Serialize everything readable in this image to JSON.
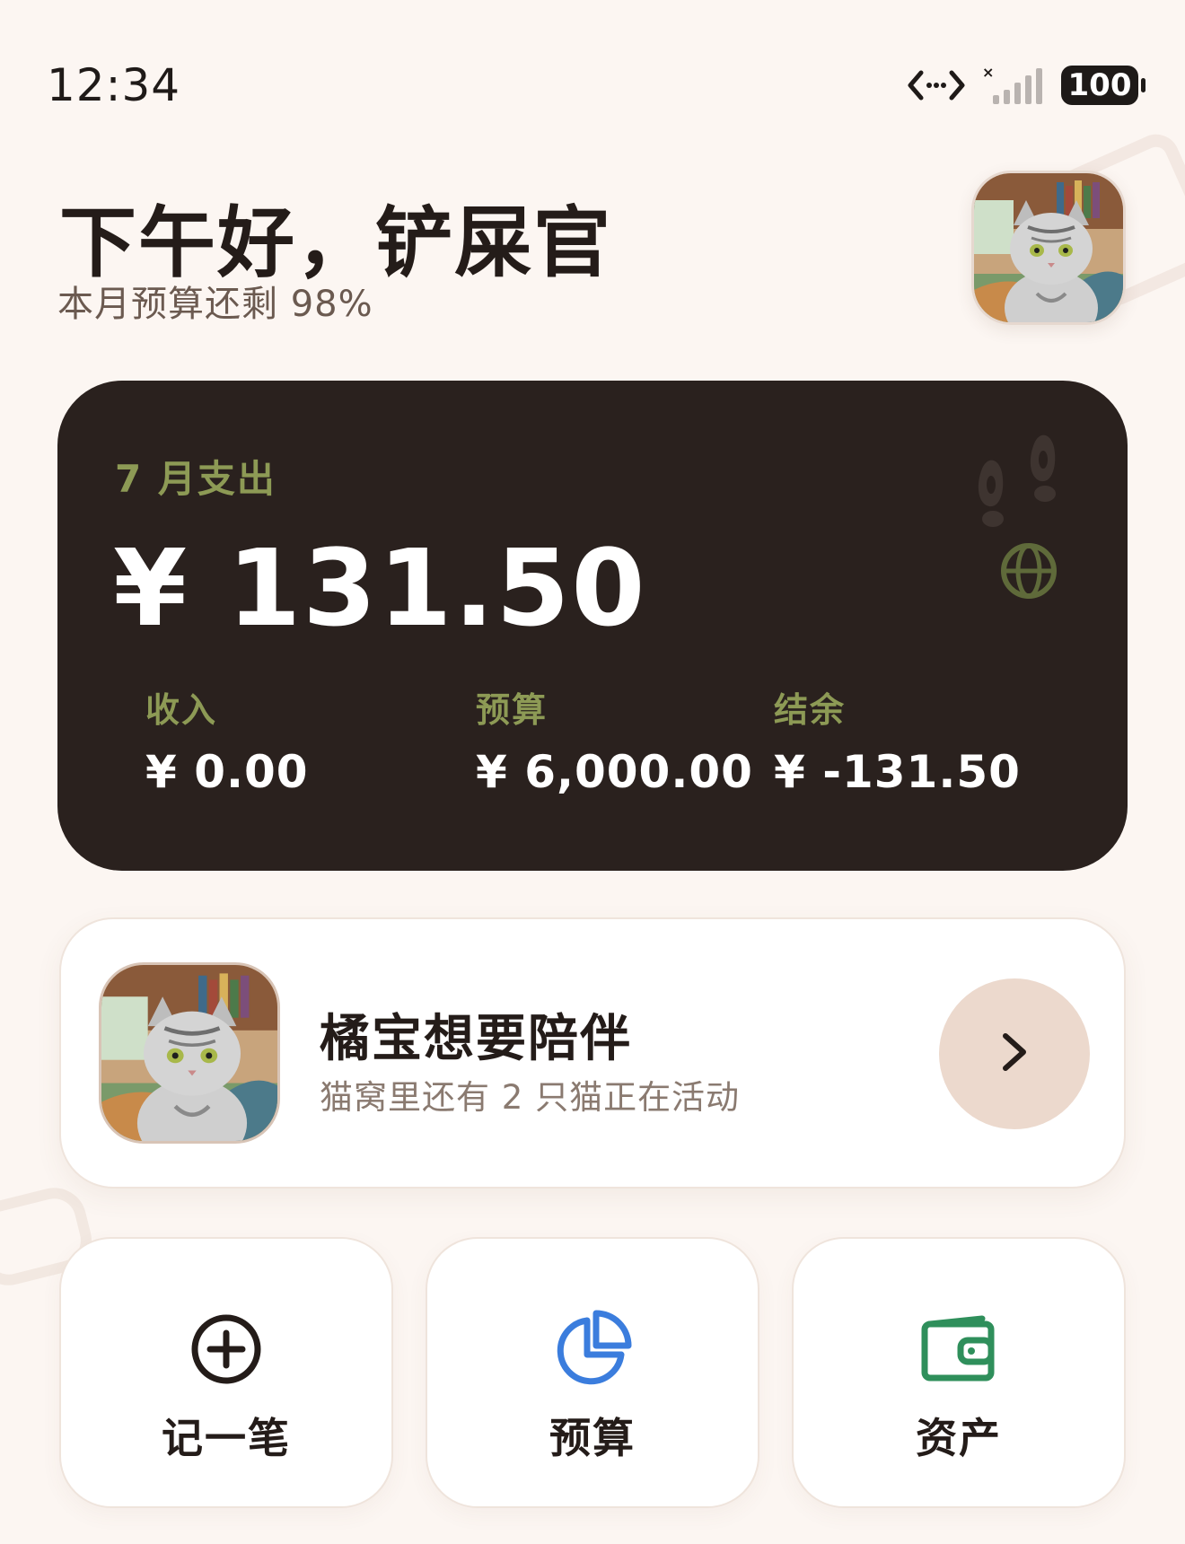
{
  "status_bar": {
    "time": "12:34",
    "battery": "100",
    "icons": [
      "data-transfer-icon",
      "no-signal-icon",
      "battery-icon"
    ]
  },
  "header": {
    "greeting": "下午好，铲屎官",
    "subtitle": "本月预算还剩 98%",
    "avatar_icon": "cat-avatar"
  },
  "summary": {
    "month_label": "7 月支出",
    "amount": "¥ 131.50",
    "income_label": "收入",
    "income_value": "¥ 0.00",
    "budget_label": "预算",
    "budget_value": "¥ 6,000.00",
    "balance_label": "结余",
    "balance_value": "¥ -131.50",
    "icons": [
      "footprints-icon",
      "globe-icon"
    ],
    "accent_color": "#8d9a55",
    "background_color": "#2a211e"
  },
  "cat_card": {
    "title": "橘宝想要陪伴",
    "subtitle": "猫窝里还有 2 只猫正在活动",
    "action_icon": "chevron-right-icon"
  },
  "actions": [
    {
      "label": "记一笔",
      "icon": "plus-circle-icon",
      "color": "#241c19"
    },
    {
      "label": "预算",
      "icon": "pie-chart-icon",
      "color": "#3b7ddd"
    },
    {
      "label": "资产",
      "icon": "wallet-icon",
      "color": "#2f8f5b"
    }
  ]
}
